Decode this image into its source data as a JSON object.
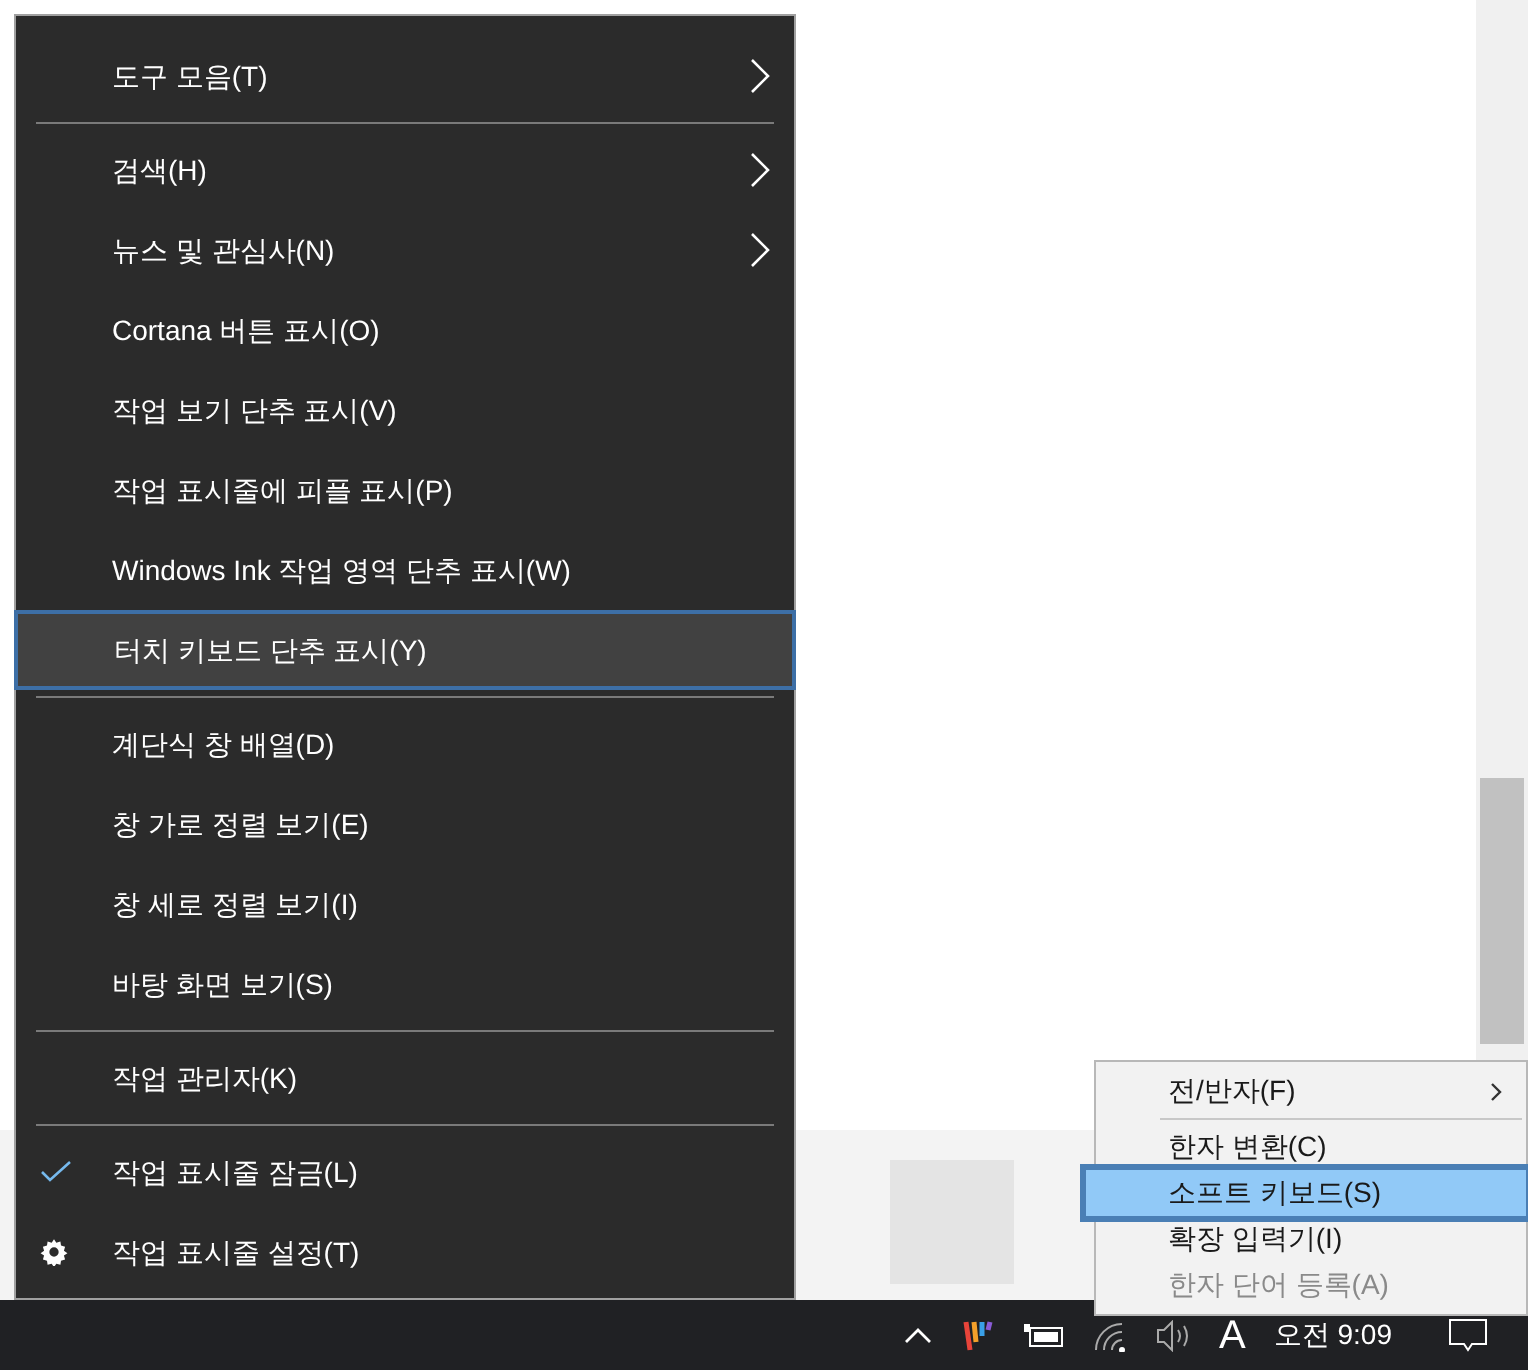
{
  "context_menu": {
    "items": [
      {
        "kind": "item",
        "label": "도구 모음(T)",
        "submenu": true,
        "checked": false,
        "selected": false
      },
      {
        "kind": "separator"
      },
      {
        "kind": "item",
        "label": "검색(H)",
        "submenu": true,
        "checked": false,
        "selected": false
      },
      {
        "kind": "item",
        "label": "뉴스 및 관심사(N)",
        "submenu": true,
        "checked": false,
        "selected": false
      },
      {
        "kind": "item",
        "label": "Cortana 버튼 표시(O)",
        "submenu": false,
        "checked": false,
        "selected": false
      },
      {
        "kind": "item",
        "label": "작업 보기 단추 표시(V)",
        "submenu": false,
        "checked": false,
        "selected": false
      },
      {
        "kind": "item",
        "label": "작업 표시줄에 피플 표시(P)",
        "submenu": false,
        "checked": false,
        "selected": false
      },
      {
        "kind": "item",
        "label": "Windows Ink 작업 영역 단추 표시(W)",
        "submenu": false,
        "checked": false,
        "selected": false
      },
      {
        "kind": "item",
        "label": "터치 키보드 단추 표시(Y)",
        "submenu": false,
        "checked": false,
        "selected": true
      },
      {
        "kind": "separator"
      },
      {
        "kind": "item",
        "label": "계단식 창 배열(D)",
        "submenu": false,
        "checked": false,
        "selected": false
      },
      {
        "kind": "item",
        "label": "창 가로 정렬 보기(E)",
        "submenu": false,
        "checked": false,
        "selected": false
      },
      {
        "kind": "item",
        "label": "창 세로 정렬 보기(I)",
        "submenu": false,
        "checked": false,
        "selected": false
      },
      {
        "kind": "item",
        "label": "바탕 화면 보기(S)",
        "submenu": false,
        "checked": false,
        "selected": false
      },
      {
        "kind": "separator"
      },
      {
        "kind": "item",
        "label": "작업 관리자(K)",
        "submenu": false,
        "checked": false,
        "selected": false
      },
      {
        "kind": "separator"
      },
      {
        "kind": "item",
        "label": "작업 표시줄 잠금(L)",
        "submenu": false,
        "checked": true,
        "selected": false
      },
      {
        "kind": "settings",
        "label": "작업 표시줄 설정(T)",
        "submenu": false,
        "checked": false,
        "selected": false
      }
    ]
  },
  "ime_menu": {
    "items": [
      {
        "kind": "item",
        "label": "전/반자(F)",
        "submenu": true,
        "disabled": false,
        "selected": false
      },
      {
        "kind": "separator"
      },
      {
        "kind": "item",
        "label": "한자 변환(C)",
        "submenu": false,
        "disabled": false,
        "selected": false
      },
      {
        "kind": "item",
        "label": "소프트 키보드(S)",
        "submenu": false,
        "disabled": false,
        "selected": true
      },
      {
        "kind": "item",
        "label": "확장 입력기(I)",
        "submenu": false,
        "disabled": false,
        "selected": false
      },
      {
        "kind": "item",
        "label": "한자 단어 등록(A)",
        "submenu": false,
        "disabled": true,
        "selected": false
      }
    ]
  },
  "taskbar": {
    "input_indicator": "A",
    "clock": "오전 9:09"
  }
}
